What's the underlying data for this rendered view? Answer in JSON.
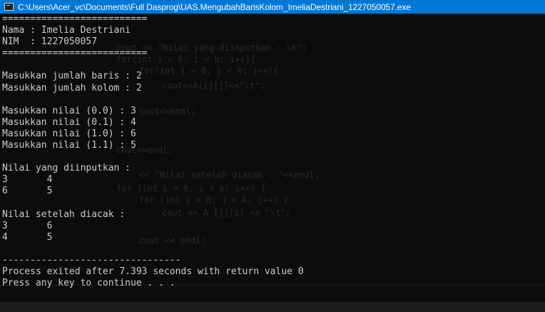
{
  "window": {
    "title": "C:\\Users\\Acer_vc\\Documents\\Full Dasprog\\UAS.MengubahBarisKolom_ImeliaDestriani_1227050057.exe"
  },
  "console": {
    "lines": [
      "==========================",
      "Nama : Imelia Destriani",
      "NIM  : 1227050057",
      "==========================",
      "",
      "Masukkan jumlah baris : 2",
      "Masukkan jumlah kolom : 2",
      "",
      "Masukkan nilai (0.0) : 3",
      "Masukkan nilai (0.1) : 4",
      "Masukkan nilai (1.0) : 6",
      "Masukkan nilai (1.1) : 5",
      "",
      "Nilai yang diinputkan :",
      "3       4",
      "6       5",
      "",
      "Nilai setelah diacak :",
      "3       6",
      "4       5",
      "",
      "--------------------------------",
      "Process exited after 7.393 seconds with return value 0",
      "Press any key to continue . . ."
    ]
  }
}
